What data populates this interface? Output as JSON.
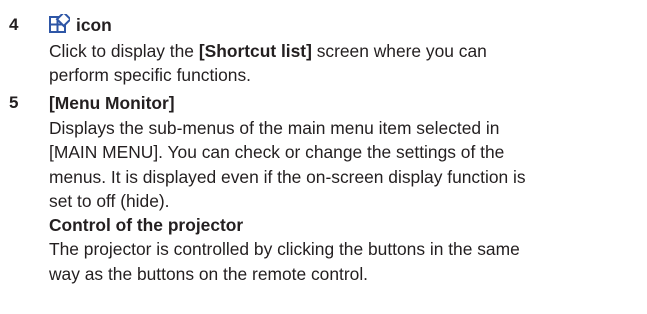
{
  "colors": {
    "text": "#231f20",
    "icon": "#2e56a6"
  },
  "items": [
    {
      "number": "4",
      "heading": "icon",
      "icon_name": "shortcut-list-icon",
      "paragraph_lines": [
        {
          "before": "Click to display the ",
          "bold": "[Shortcut list]",
          "after": " screen where you can"
        },
        {
          "text": "perform specific functions."
        }
      ]
    },
    {
      "number": "5",
      "heading": "[Menu Monitor]",
      "paragraph_lines": [
        "Displays the sub-menus of the main menu item selected in",
        "[MAIN MENU]. You can check or change the settings of the",
        "menus. It is displayed even if the on-screen display function is",
        "set to off (hide)."
      ],
      "subheading": "Control of the projector",
      "sub_paragraph_lines": [
        "The projector is controlled by clicking the buttons in the same",
        "way as the buttons on the remote control."
      ]
    }
  ]
}
